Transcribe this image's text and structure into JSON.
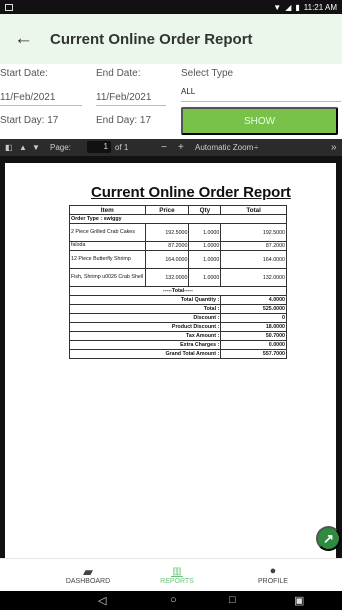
{
  "status": {
    "time": "11:21 AM",
    "wifi_icon": "wifi-icon",
    "battery_icon": "battery-icon"
  },
  "appbar": {
    "back_icon": "back-arrow-icon",
    "title": "Current Online Order Report"
  },
  "filters": {
    "start_date_label": "Start Date:",
    "start_date_value": "11/Feb/2021",
    "start_day": "Start Day: 17",
    "end_date_label": "End Date:",
    "end_date_value": "11/Feb/2021",
    "end_day": "End Day: 17",
    "select_label": "Select Type",
    "select_value": "ALL",
    "show_button": "SHOW"
  },
  "pdf_toolbar": {
    "page_label": "Page:",
    "page_number": "1",
    "page_total": "of 1",
    "zoom": "Automatic Zoom",
    "more": "»",
    "minus": "−",
    "plus": "+",
    "zoom_arrow": "÷"
  },
  "report": {
    "title": "Current Online Order Report",
    "headers": [
      "Item",
      "Price",
      "Qty",
      "Total"
    ],
    "order_type": "Order Type : swiggy",
    "rows": [
      {
        "item": "2 Piece Grilled Crab Cakes",
        "price": "192.5000",
        "qty": "1.0000",
        "total": "192.5000"
      },
      {
        "item": "faloda",
        "price": "87.2000",
        "qty": "1.0000",
        "total": "87.2000"
      },
      {
        "item": "12 Piece Butterfly Shrimp",
        "price": "164.0000",
        "qty": "1.0000",
        "total": "164.0000"
      },
      {
        "item": "Fish, Shrimp u0026 Crab Shell",
        "price": "132.0000",
        "qty": "1.0000",
        "total": "132.0000"
      }
    ],
    "total_header": "-----Total-----",
    "summary": [
      {
        "label": "Total Quantity :",
        "value": "4.0000"
      },
      {
        "label": "Total :",
        "value": "525.0000"
      },
      {
        "label": "Discount :",
        "value": "0"
      },
      {
        "label": "Product Discount :",
        "value": "18.0000"
      },
      {
        "label": "Tax Amount :",
        "value": "50.7000"
      },
      {
        "label": "Extra Charges :",
        "value": "0.0000"
      },
      {
        "label": "Grand Total Amount :",
        "value": "557.7000"
      }
    ]
  },
  "bottom_nav": {
    "dashboard": "DASHBOARD",
    "reports": "REPORTS",
    "profile": "PROFILE"
  }
}
